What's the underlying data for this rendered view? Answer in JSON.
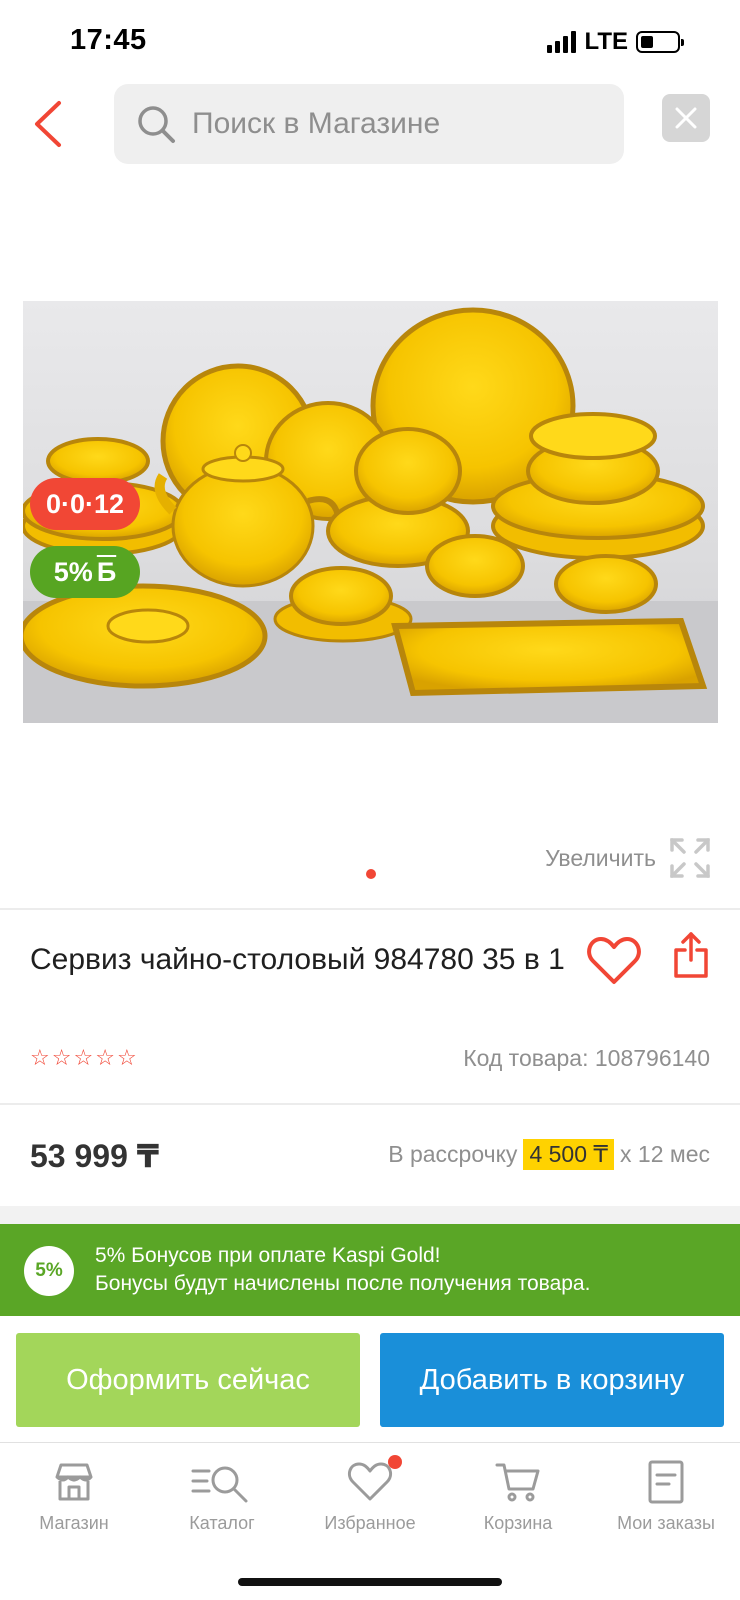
{
  "status_bar": {
    "time": "17:45",
    "network": "LTE",
    "battery_level": 0.35
  },
  "header": {
    "back_icon": "chevron-left-icon",
    "search_placeholder": "Поиск в Магазине",
    "close_icon": "close-icon"
  },
  "product": {
    "badge_installment": "0·0·12",
    "badge_bonus_value": "5%",
    "badge_bonus_symbol": "Б",
    "zoom_label": "Увеличить",
    "image_count": 1,
    "current_image": 1,
    "title": "Сервиз чайно-столовый 984780 35 в 1",
    "rating_stars": 0,
    "rating_max": 5,
    "code_label": "Код товара: 108796140",
    "price": "53 999 ₸",
    "installment_prefix": "В рассрочку",
    "installment_amount": "4 500 ₸",
    "installment_suffix": "х 12 мес"
  },
  "bonus_banner": {
    "circle": "5%",
    "line1": "5% Бонусов при оплате Kaspi Gold!",
    "line2": "Бонусы будут начислены после получения товара."
  },
  "actions": {
    "buy_now": "Оформить сейчас",
    "add_to_cart": "Добавить в корзину"
  },
  "tab_bar": {
    "items": [
      {
        "label": "Магазин",
        "icon": "store-icon"
      },
      {
        "label": "Каталог",
        "icon": "catalog-search-icon"
      },
      {
        "label": "Избранное",
        "icon": "heart-icon",
        "has_notification": true
      },
      {
        "label": "Корзина",
        "icon": "cart-icon"
      },
      {
        "label": "Мои заказы",
        "icon": "orders-icon"
      }
    ]
  },
  "colors": {
    "accent_red": "#f14635",
    "bonus_green": "#5aa626",
    "buy_button": "#a3d65a",
    "cart_button": "#1a8fd9",
    "installment_highlight": "#ffd200"
  }
}
